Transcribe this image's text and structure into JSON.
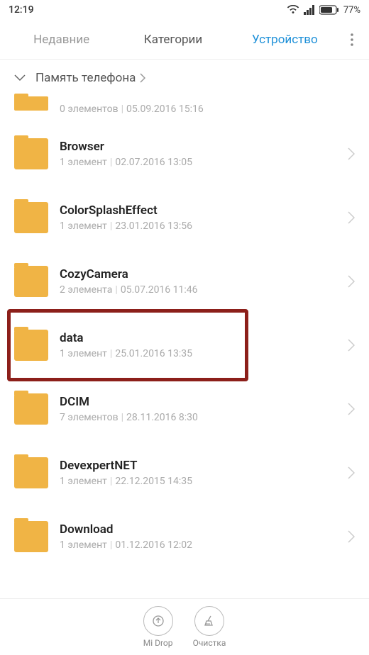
{
  "statusbar": {
    "time": "12:19",
    "battery": "77%"
  },
  "tabs": {
    "recent": "Недавние",
    "categories": "Категории",
    "device": "Устройство"
  },
  "breadcrumb": {
    "label": "Память телефона"
  },
  "partial": {
    "count": "0 элементов",
    "date": "05.09.2016 15:16"
  },
  "folders": [
    {
      "name": "Browser",
      "count": "1 элемент",
      "date": "02.07.2016 13:05",
      "highlighted": false
    },
    {
      "name": "ColorSplashEffect",
      "count": "1 элемент",
      "date": "23.01.2016 13:56",
      "highlighted": false
    },
    {
      "name": "CozyCamera",
      "count": "2 элемента",
      "date": "05.07.2016 11:46",
      "highlighted": false
    },
    {
      "name": "data",
      "count": "1 элемент",
      "date": "25.01.2016 13:35",
      "highlighted": true
    },
    {
      "name": "DCIM",
      "count": "7 элементов",
      "date": "28.11.2016 8:30",
      "highlighted": false
    },
    {
      "name": "DevexpertNET",
      "count": "1 элемент",
      "date": "22.12.2015 14:35",
      "highlighted": false
    },
    {
      "name": "Download",
      "count": "1 элемент",
      "date": "01.12.2016 12:02",
      "highlighted": false
    }
  ],
  "bottom": {
    "midrop": "Mi Drop",
    "cleanup": "Очистка"
  }
}
